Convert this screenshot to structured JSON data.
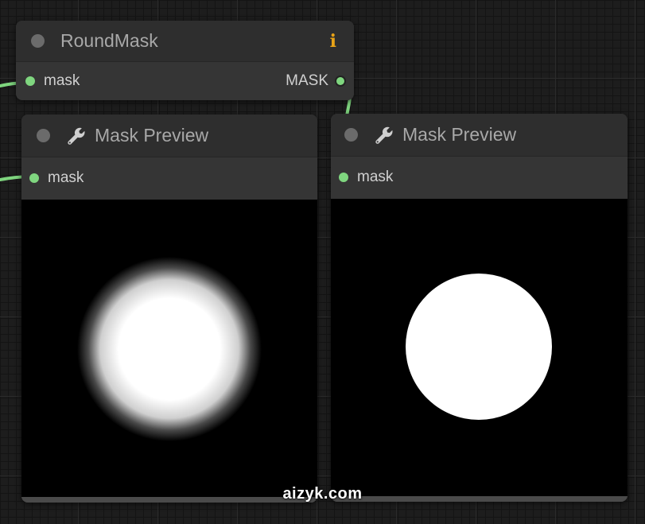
{
  "round_mask_node": {
    "title": "RoundMask",
    "info_glyph": "i",
    "input_label": "mask",
    "output_label": "MASK"
  },
  "preview_node_left": {
    "title": "Mask Preview",
    "input_label": "mask",
    "preview": "soft-edge-circle"
  },
  "preview_node_right": {
    "title": "Mask Preview",
    "input_label": "mask",
    "preview": "hard-edge-circle"
  },
  "watermark": "aizyk.com",
  "colors": {
    "wire": "#7fd67f",
    "info": "#e8a317",
    "node_body": "#353535",
    "node_title": "#2e2e2e",
    "canvas": "#1d1d1d"
  }
}
